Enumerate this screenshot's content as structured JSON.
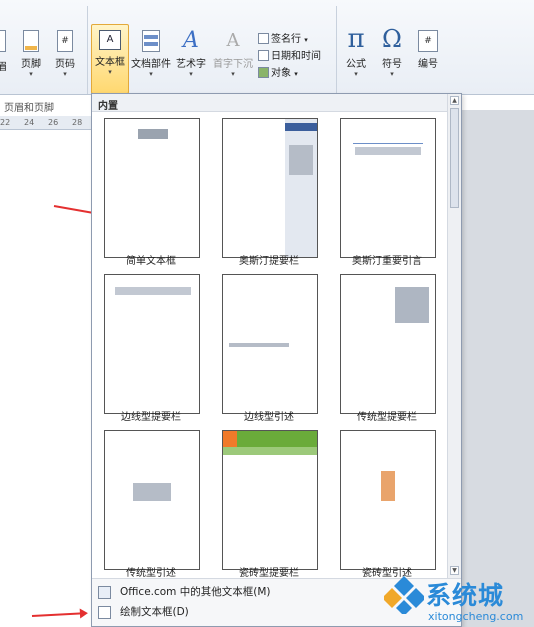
{
  "ribbon": {
    "left_cut_label": "眉",
    "footer_label": "页脚",
    "page_number_label": "页码",
    "textbox_label": "文本框",
    "quickparts_label": "文档部件",
    "wordart_label": "艺术字",
    "dropcap_label": "首字下沉",
    "signature_label": "签名行",
    "datetime_label": "日期和时间",
    "object_label": "对象",
    "equation_label": "公式",
    "symbol_label": "符号",
    "numbering_label": "编号",
    "group_header_footer": "页眉和页脚",
    "pi": "π",
    "omega": "Ω"
  },
  "ruler": {
    "ticks": [
      "22",
      "24",
      "26",
      "28"
    ]
  },
  "gallery": {
    "header": "内置",
    "tiles": [
      {
        "label": "简单文本框"
      },
      {
        "label": "奥斯汀提要栏"
      },
      {
        "label": "奥斯汀重要引言"
      },
      {
        "label": "边线型提要栏"
      },
      {
        "label": "边线型引述"
      },
      {
        "label": "传统型提要栏"
      },
      {
        "label": "传统型引述"
      },
      {
        "label": "瓷砖型提要栏"
      },
      {
        "label": "瓷砖型引述"
      }
    ],
    "footer_items": [
      {
        "label": "Office.com 中的其他文本框(M)"
      },
      {
        "label": "绘制文本框(D)"
      }
    ]
  },
  "watermark": {
    "brand": "系统城",
    "url": "xitongcheng.com"
  },
  "colors": {
    "accent_arrow": "#e43030",
    "tile_orange": "#f07a2a",
    "tile_green": "#6aab3a",
    "austin_blue": "#3b5e9c"
  }
}
